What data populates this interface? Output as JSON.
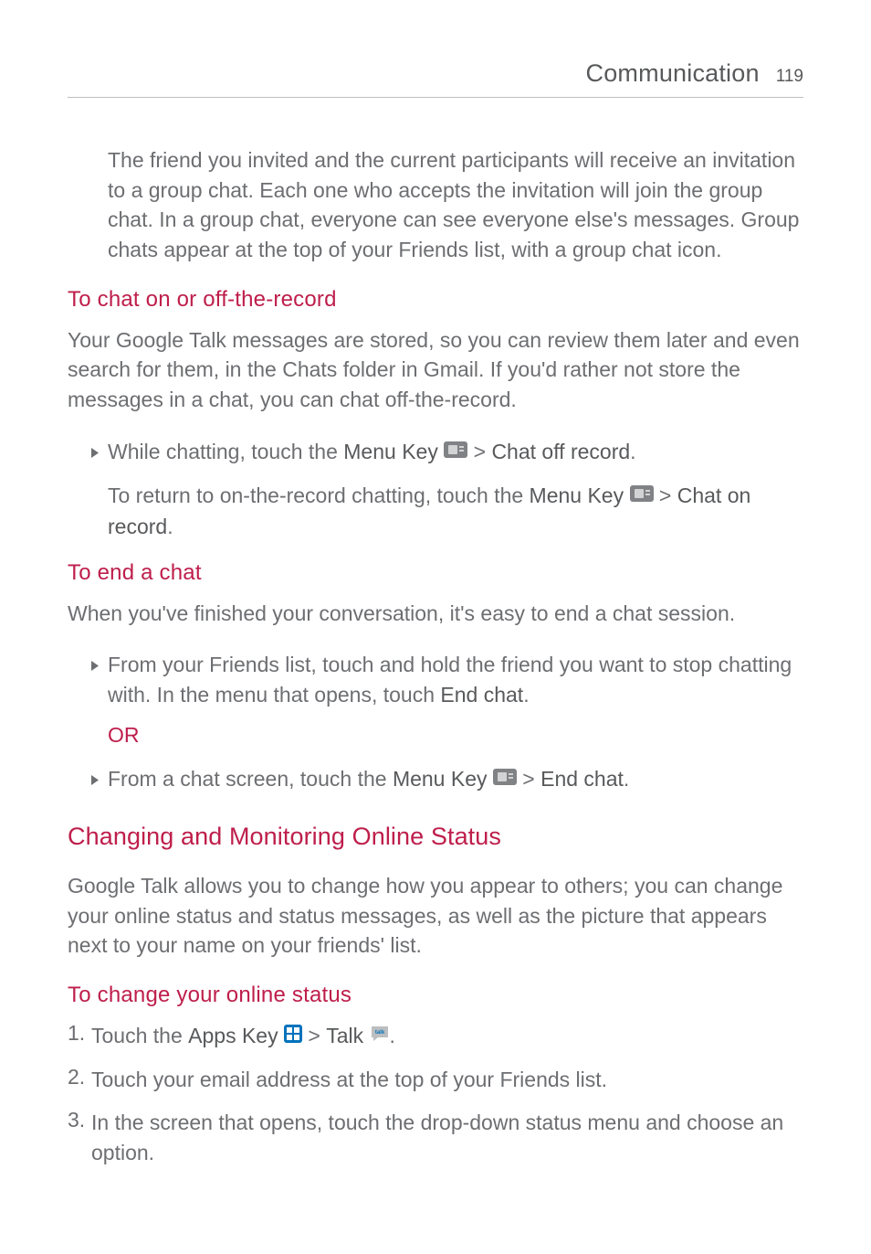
{
  "header": {
    "title": "Communication",
    "page_number": "119"
  },
  "para_intro": "The friend you invited and the current participants will receive an invitation to a group chat. Each one who accepts the invitation will join the group chat. In a group chat, everyone can see everyone else's messages. Group chats appear at the top of your Friends list, with a group chat icon.",
  "heading_record": "To chat on or off-the-record",
  "para_record": "Your Google Talk messages are stored, so you can review them later and even search for them, in the Chats folder in Gmail. If you'd rather not store the messages in a chat, you can chat off-the-record.",
  "bullet_record_prefix": "While chatting, touch the ",
  "menu_key_label": "Menu Key",
  "gt": " > ",
  "chat_off_record": "Chat off record",
  "period": ".",
  "bullet_record_follow_pre": "To return to on-the-record chatting, touch the ",
  "chat_on_record": "Chat on record",
  "heading_end": "To end a chat",
  "para_end": "When you've finished your conversation, it's easy to end a chat session.",
  "bullet_end_1_pre": "From your Friends list, touch and hold the friend you want to stop chatting with. In the menu that opens, touch ",
  "end_chat": "End chat",
  "or_label": "OR",
  "bullet_end_2_pre": "From a chat screen, touch the ",
  "section_heading": "Changing and Monitoring Online Status",
  "para_status": "Google Talk allows you to change how you appear to others; you can change your online status and status messages, as well as the picture that appears next to your name on your friends' list.",
  "heading_change_status": "To change your online status",
  "step1_pre": "Touch the ",
  "apps_key": "Apps Key",
  "talk": "Talk",
  "step2": "Touch your email address at the top of your Friends list.",
  "step3": "In the screen that opens, touch the drop-down status menu and choose an option."
}
